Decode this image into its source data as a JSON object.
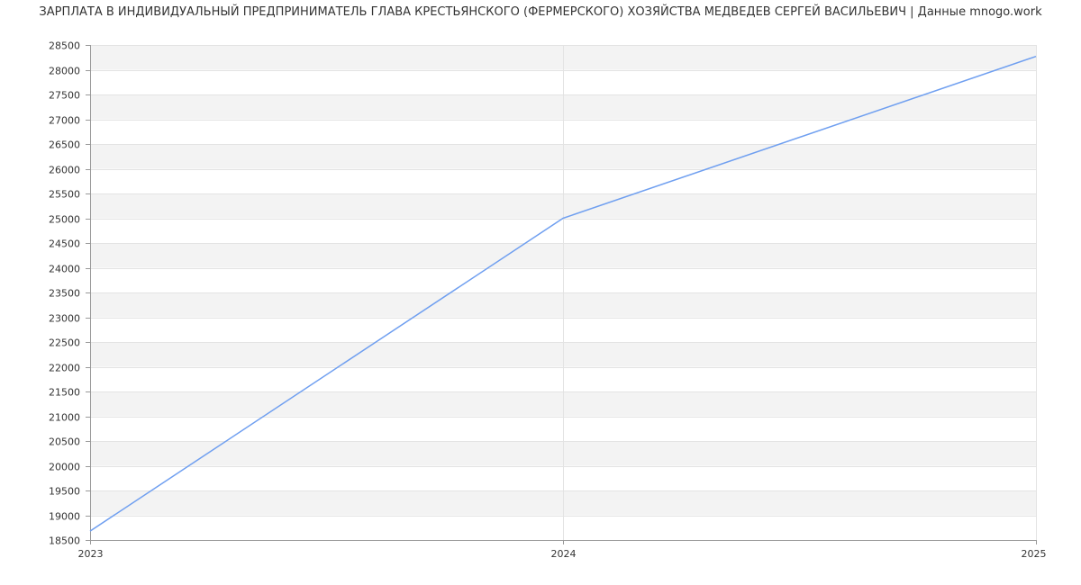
{
  "chart_data": {
    "type": "line",
    "title": "ЗАРПЛАТА В ИНДИВИДУАЛЬНЫЙ ПРЕДПРИНИМАТЕЛЬ ГЛАВА КРЕСТЬЯНСКОГО (ФЕРМЕРСКОГО) ХОЗЯЙСТВА МЕДВЕДЕВ СЕРГЕЙ ВАСИЛЬЕВИЧ | Данные mnogo.work",
    "xlabel": "",
    "ylabel": "",
    "x": [
      "2023",
      "2024",
      "2025"
    ],
    "series": [
      {
        "values": [
          18680,
          25000,
          28270
        ]
      }
    ],
    "ylim": [
      18500,
      28500
    ],
    "ytick_step": 500,
    "grid": true,
    "line_color": "#6f9ff0",
    "band_color": "#f3f3f3",
    "grid_color": "#e3e3e3",
    "axis_color": "#999999"
  }
}
